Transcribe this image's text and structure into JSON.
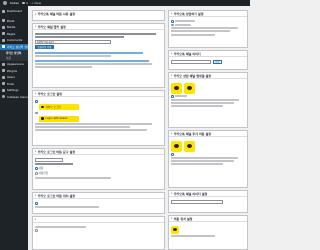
{
  "adminbar": {
    "site_name": "Kakao",
    "comments_count": "0",
    "new_label": "+ New"
  },
  "sidebar": {
    "items": [
      {
        "label": "Dashboard"
      },
      {
        "label": "Posts"
      },
      {
        "label": "Media"
      },
      {
        "label": "Pages"
      },
      {
        "label": "Comments"
      },
      {
        "label": "카카오 상담톡 설정"
      },
      {
        "label": "Appearance"
      },
      {
        "label": "Plugins"
      },
      {
        "label": "Users"
      },
      {
        "label": "Tools"
      },
      {
        "label": "Settings"
      },
      {
        "label": "Collapse menu"
      }
    ],
    "submenu": [
      {
        "label": "카카오 상담톡"
      },
      {
        "label": "설정"
      }
    ]
  },
  "panels": {
    "usage": {
      "title": "카카오톡 채널 버튼 사용 설정"
    },
    "keys": {
      "title": "카카오 채널 앱키 설정",
      "app_key_value": "b0f8c3a1e9d…",
      "button_label": "변경사항 저장"
    },
    "button_style": {
      "title": "카카오 로그인 설정"
    },
    "login_text": {
      "title": "카카오 로그인 버튼 문구 설정",
      "radio_on": "사용",
      "radio_off": "사용안함"
    },
    "bottom_left": {
      "title": "카카오 로그인 버튼 위치 설정"
    },
    "r_usage": {
      "title": "카카오톡 상담하기 설정"
    },
    "r_channel": {
      "title": "카카오톡 채널 아이디",
      "button_label": "저장"
    },
    "r_share": {
      "title": "카카오 상담 채널 썸네일 설정"
    },
    "r_icon": {
      "title": "카카오톡 채널 추가 버튼 설정"
    },
    "r_bottom": {
      "title": "카카오톡 채널 아이디 설정"
    },
    "r_last": {
      "title": "버튼 위치 설정"
    }
  },
  "login_buttons": {
    "kakao_label": "카카오 로그인",
    "kakao_label_2": "Login with Kakao"
  }
}
